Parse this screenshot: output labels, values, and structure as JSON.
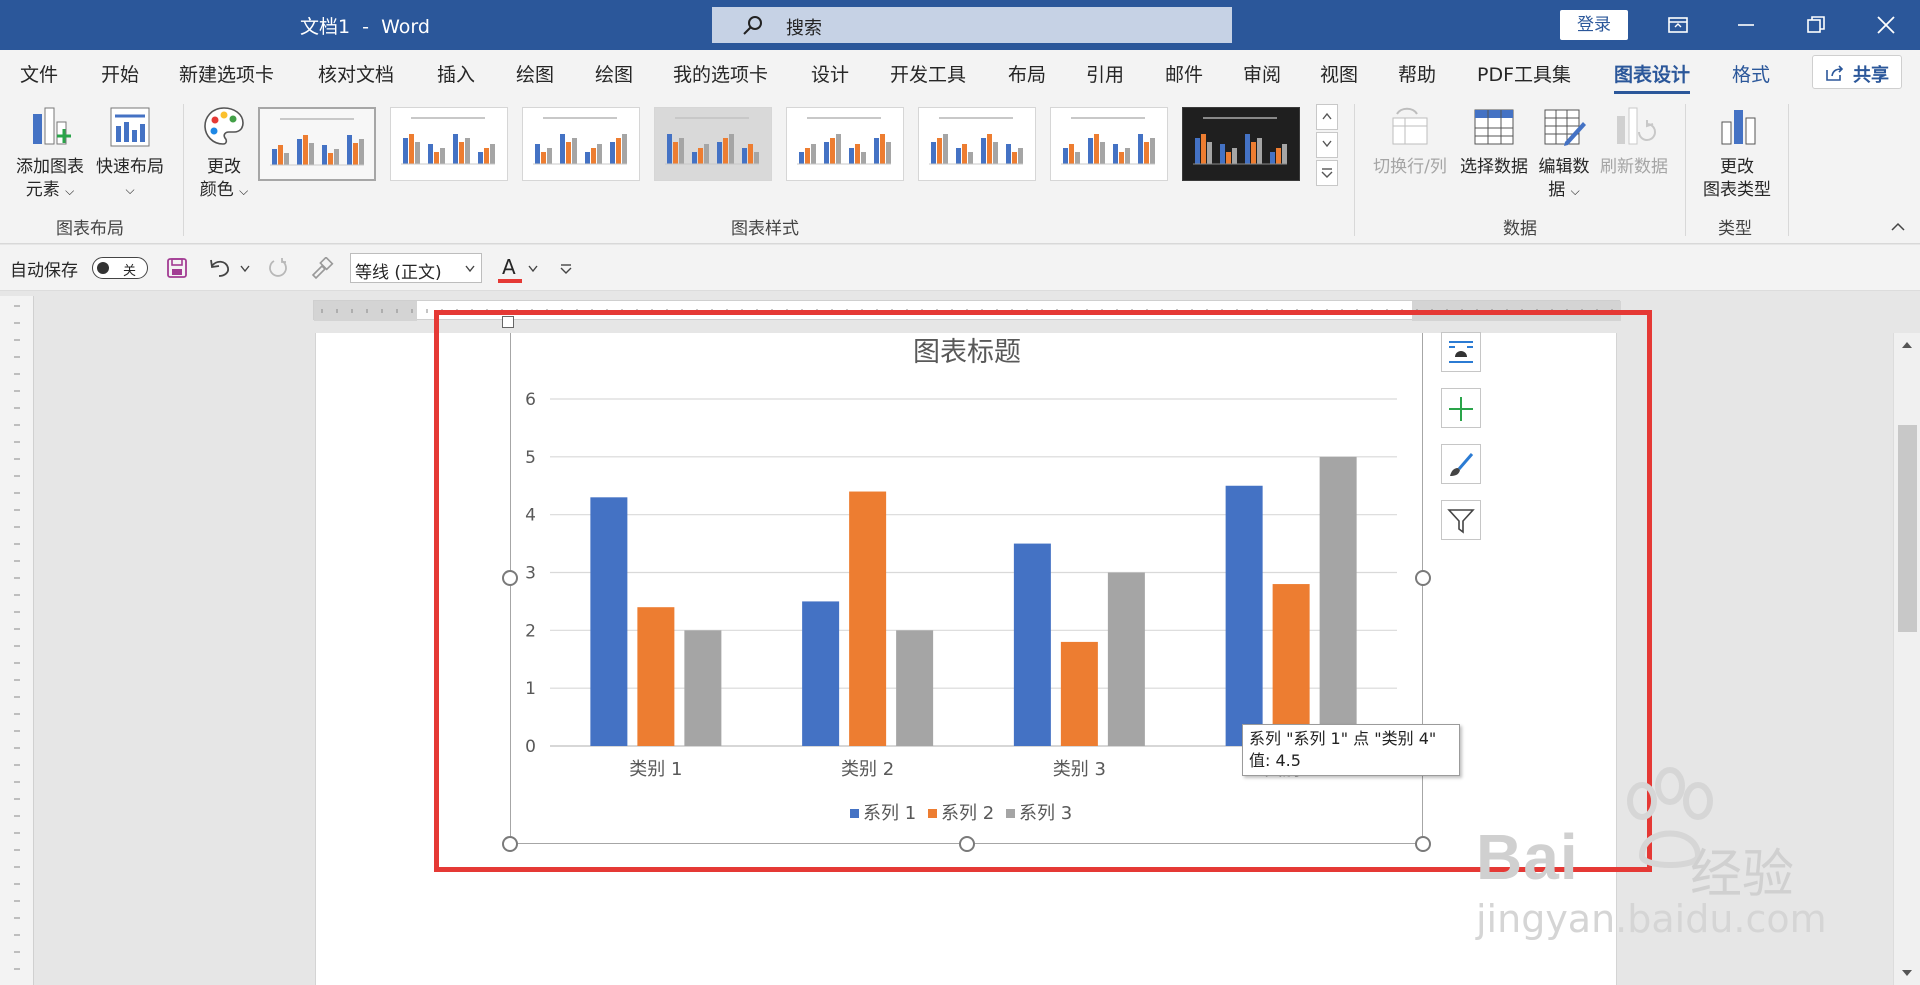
{
  "titlebar": {
    "doc_title": "文档1  -  Word",
    "search_placeholder": "搜索",
    "login_label": "登录",
    "bg_color": "#2b579a"
  },
  "tabs": [
    "文件",
    "开始",
    "新建选项卡",
    "核对文档",
    "插入",
    "绘图",
    "绘图",
    "我的选项卡",
    "设计",
    "开发工具",
    "布局",
    "引用",
    "邮件",
    "审阅",
    "视图",
    "帮助",
    "PDF工具集",
    "图表设计",
    "格式"
  ],
  "active_tab": "图表设计",
  "share_label": "共享",
  "ribbon": {
    "layout_group": {
      "add_element_line1": "添加图表",
      "add_element_line2": "元素",
      "quick_layout": "快速布局",
      "label": "图表布局"
    },
    "styles_group": {
      "change_color_line1": "更改",
      "change_color_line2": "颜色",
      "label": "图表样式"
    },
    "data_group": {
      "switch_row_col": "切换行/列",
      "select_data": "选择数据",
      "edit_data_line1": "编辑数",
      "edit_data_line2": "据",
      "refresh_data": "刷新数据",
      "label": "数据"
    },
    "type_group": {
      "change_type_line1": "更改",
      "change_type_line2": "图表类型",
      "label": "类型"
    }
  },
  "qat": {
    "autosave_label": "自动保存",
    "autosave_state": "关",
    "font_name": "等线 (正文)",
    "font_color_letter": "A"
  },
  "chart_data": {
    "type": "bar",
    "title": "图表标题",
    "categories": [
      "类别 1",
      "类别 2",
      "类别 3",
      "类别 4"
    ],
    "series": [
      {
        "name": "系列 1",
        "values": [
          4.3,
          2.5,
          3.5,
          4.5
        ],
        "color": "#4472c4"
      },
      {
        "name": "系列 2",
        "values": [
          2.4,
          4.4,
          1.8,
          2.8
        ],
        "color": "#ed7d31"
      },
      {
        "name": "系列 3",
        "values": [
          2.0,
          2.0,
          3.0,
          5.0
        ],
        "color": "#a5a5a5"
      }
    ],
    "ylim": [
      0,
      6
    ],
    "yticks": [
      "0",
      "1",
      "2",
      "3",
      "4",
      "5",
      "6"
    ],
    "grid": true,
    "legend_position": "bottom"
  },
  "tooltip": {
    "line1": "系列 \"系列 1\" 点 \"类别 4\"",
    "line2": "值: 4.5"
  },
  "watermark": {
    "brand": "Bai",
    "brand_cn": "经验",
    "url": "jingyan.baidu.com"
  },
  "colors": {
    "accent": "#2b579a",
    "highlight_box": "#e53935"
  }
}
